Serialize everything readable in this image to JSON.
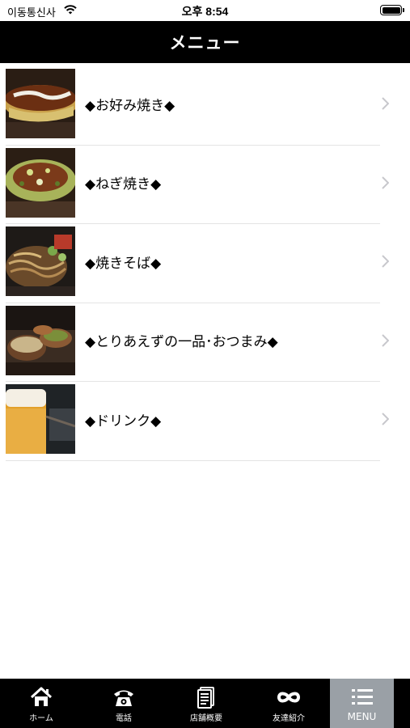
{
  "status_bar": {
    "carrier": "이동통신사",
    "time": "오후 8:54"
  },
  "nav": {
    "title": "メニュー"
  },
  "menu_items": [
    {
      "label": "◆お好み焼き◆",
      "thumb": "okonomiyaki-photo"
    },
    {
      "label": "◆ねぎ焼き◆",
      "thumb": "negiyaki-photo"
    },
    {
      "label": "◆焼きそば◆",
      "thumb": "yakisoba-photo"
    },
    {
      "label": "◆とりあえずの一品･おつまみ◆",
      "thumb": "side-dishes-photo"
    },
    {
      "label": "◆ドリンク◆",
      "thumb": "beer-photo"
    }
  ],
  "tabs": [
    {
      "label": "ホーム",
      "icon": "home-icon"
    },
    {
      "label": "電話",
      "icon": "phone-icon"
    },
    {
      "label": "店舗概要",
      "icon": "document-icon"
    },
    {
      "label": "友達紹介",
      "icon": "infinity-icon"
    },
    {
      "label": "MENU",
      "icon": "list-icon",
      "active": true
    }
  ],
  "colors": {
    "nav_background": "#000000",
    "tab_bar_background": "#000000",
    "active_tab_background": "#9aa0a6",
    "separator": "#e4e4e4",
    "chevron": "#c7c7cc"
  }
}
